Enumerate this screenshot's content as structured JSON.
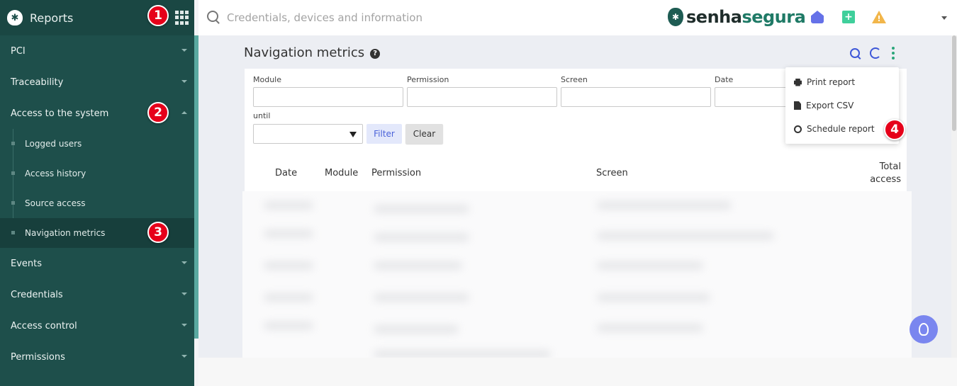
{
  "sidebar": {
    "title": "Reports",
    "items_top": [
      {
        "label": "PCI",
        "caret": "down"
      },
      {
        "label": "Traceability",
        "caret": "down"
      },
      {
        "label": "Access to the system",
        "caret": "up"
      }
    ],
    "subitems": [
      {
        "label": "Logged users"
      },
      {
        "label": "Access history"
      },
      {
        "label": "Source access"
      },
      {
        "label": "Navigation metrics",
        "active": true
      }
    ],
    "items_bottom": [
      {
        "label": "Events"
      },
      {
        "label": "Credentials"
      },
      {
        "label": "Access control"
      },
      {
        "label": "Permissions"
      }
    ]
  },
  "badges": [
    "1",
    "2",
    "3",
    "4"
  ],
  "topbar": {
    "search_placeholder": "Credentials, devices and information",
    "brand_part1": "senha",
    "brand_part2": "segura"
  },
  "page": {
    "title": "Navigation metrics",
    "help": "?"
  },
  "filters": {
    "module_label": "Module",
    "permission_label": "Permission",
    "screen_label": "Screen",
    "date_label": "Date",
    "until_label": "until",
    "filter_button": "Filter",
    "clear_button": "Clear"
  },
  "table": {
    "headers": [
      "Date",
      "Module",
      "Permission",
      "Screen",
      "Total",
      "access"
    ]
  },
  "menu": {
    "items": [
      "Print report",
      "Export CSV",
      "Schedule report"
    ]
  },
  "colors": {
    "sidebar_bg": "#1e4f4b",
    "badge_red": "#e6001a",
    "accent_blue": "#3d57d8",
    "accent_green": "#2aa67a"
  }
}
